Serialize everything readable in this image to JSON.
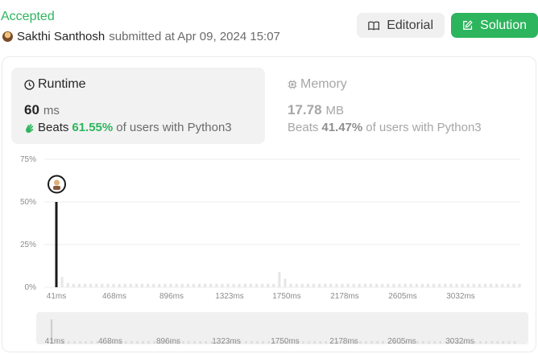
{
  "header": {
    "status": "Accepted",
    "username": "Sakthi Santhosh",
    "submitted_text": "submitted at Apr 09, 2024 15:07"
  },
  "buttons": {
    "editorial": "Editorial",
    "solution": "Solution"
  },
  "runtime": {
    "title": "Runtime",
    "value": "60",
    "unit": "ms",
    "beats_label": "Beats",
    "beats_pct": "61.55%",
    "beats_suffix": "of users with Python3"
  },
  "memory": {
    "title": "Memory",
    "value": "17.78",
    "unit": "MB",
    "beats_label": "Beats",
    "beats_pct": "41.47%",
    "beats_suffix": "of users with Python3"
  },
  "colors": {
    "accent_green": "#2db55d",
    "bar_highlight": "#1a1a1a",
    "bar_default": "#e6e6e6"
  },
  "chart_data": {
    "type": "bar",
    "yticks": [
      "75%",
      "50%",
      "25%",
      "0%"
    ],
    "ylim": [
      0,
      75
    ],
    "xticks": [
      "41ms",
      "468ms",
      "896ms",
      "1323ms",
      "1750ms",
      "2178ms",
      "2605ms",
      "3032ms"
    ],
    "highlight": {
      "x": "60ms",
      "value": 50
    },
    "series": [
      {
        "values": [
          50,
          6,
          2.5,
          2,
          2,
          2,
          2,
          2,
          2,
          2,
          2,
          2,
          2,
          2,
          2,
          2,
          2,
          2,
          2,
          2,
          2,
          2,
          2,
          2,
          2,
          2,
          2,
          2,
          2,
          2,
          2,
          2,
          2,
          2,
          2,
          2,
          2,
          2,
          2,
          9,
          5,
          2,
          2,
          2,
          2,
          2,
          2,
          2,
          2,
          2,
          2,
          2,
          2,
          2,
          2,
          2,
          2,
          2,
          2,
          2,
          2,
          2,
          2,
          2,
          2,
          2,
          2,
          2,
          2,
          2,
          2,
          2,
          2,
          2,
          2,
          2,
          2,
          2,
          2,
          2,
          2,
          2
        ]
      }
    ],
    "grid": true,
    "legend": "none"
  },
  "mini_chart": {
    "xticks": [
      "41ms",
      "468ms",
      "896ms",
      "1323ms",
      "1750ms",
      "2178ms",
      "2605ms",
      "3032ms"
    ]
  }
}
